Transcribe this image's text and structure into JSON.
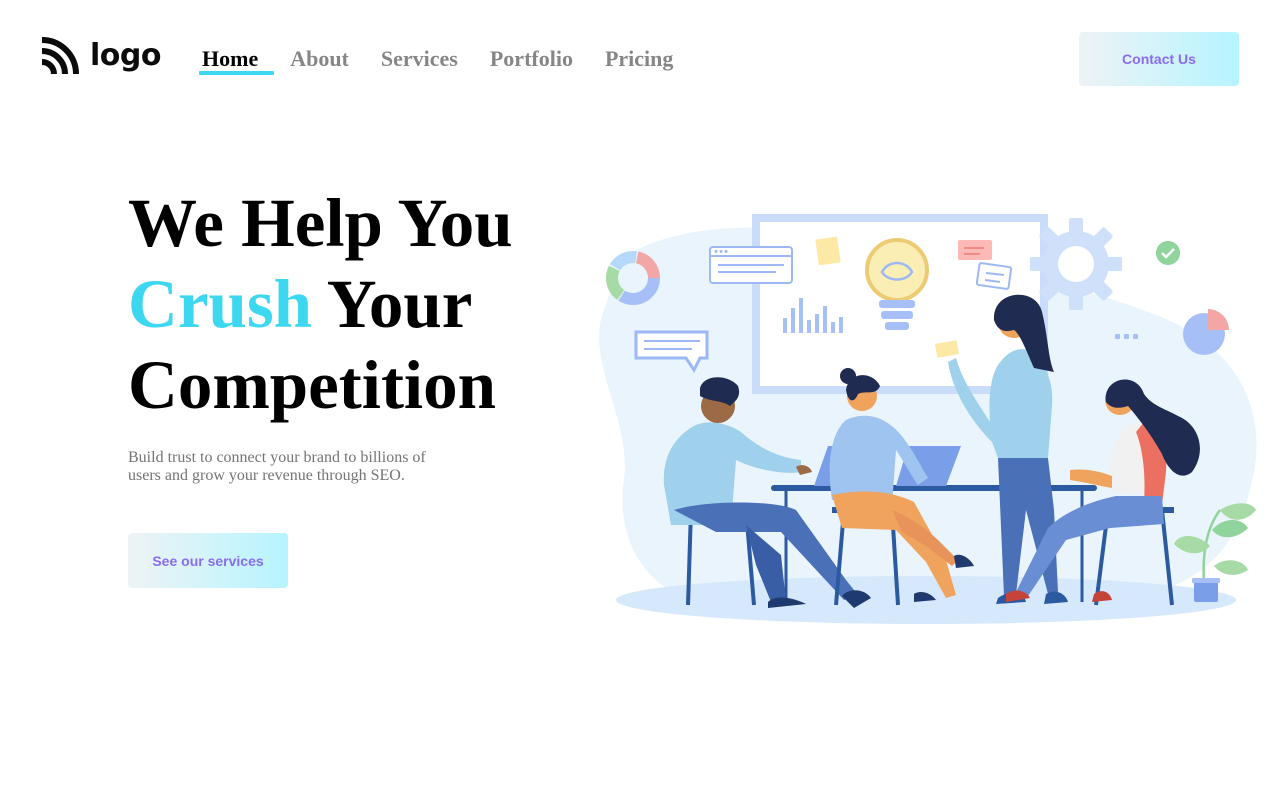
{
  "brand": {
    "logo_text": "logo",
    "logo_icon": "wifi-arcs-icon"
  },
  "nav": {
    "items": [
      {
        "label": "Home",
        "active": true
      },
      {
        "label": "About",
        "active": false
      },
      {
        "label": "Services",
        "active": false
      },
      {
        "label": "Portfolio",
        "active": false
      },
      {
        "label": "Pricing",
        "active": false
      }
    ]
  },
  "header": {
    "contact_label": "Contact Us"
  },
  "hero": {
    "title_line1": "We Help You",
    "title_accent": "Crush",
    "title_line2_rest": " Your",
    "title_line3": "Competition",
    "subtitle": "Build trust to connect your brand to billions of users and grow your revenue through SEO.",
    "cta_label": "See our services"
  },
  "colors": {
    "accent": "#3dd7ef",
    "button_text": "#8a6cf0",
    "button_gradient_start": "#eef3f5",
    "button_gradient_end": "#b6f4ff",
    "nav_inactive": "#868686"
  },
  "illustration": {
    "subject": "team-meeting-illustration"
  }
}
